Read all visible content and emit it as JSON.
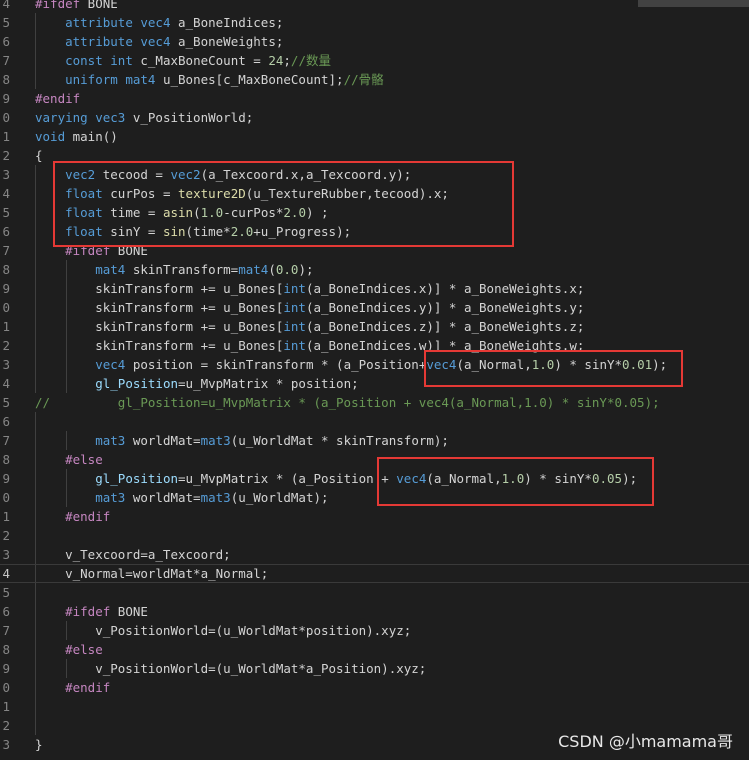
{
  "editor": {
    "lines": [
      {
        "n": "4",
        "t": "#ifdef BONE"
      },
      {
        "n": "5",
        "t": "    attribute vec4 a_BoneIndices;"
      },
      {
        "n": "6",
        "t": "    attribute vec4 a_BoneWeights;"
      },
      {
        "n": "7",
        "t": "    const int c_MaxBoneCount = 24;//数量"
      },
      {
        "n": "8",
        "t": "    uniform mat4 u_Bones[c_MaxBoneCount];//骨骼"
      },
      {
        "n": "9",
        "t": "#endif"
      },
      {
        "n": "0",
        "t": "varying vec3 v_PositionWorld;"
      },
      {
        "n": "1",
        "t": "void main()"
      },
      {
        "n": "2",
        "t": "{"
      },
      {
        "n": "3",
        "t": "    vec2 tecood = vec2(a_Texcoord.x,a_Texcoord.y);"
      },
      {
        "n": "4",
        "t": "    float curPos = texture2D(u_TextureRubber,tecood).x;"
      },
      {
        "n": "5",
        "t": "    float time = asin(1.0-curPos*2.0) ;"
      },
      {
        "n": "6",
        "t": "    float sinY = sin(time*2.0+u_Progress);"
      },
      {
        "n": "7",
        "t": "    #ifdef BONE"
      },
      {
        "n": "8",
        "t": "        mat4 skinTransform=mat4(0.0);"
      },
      {
        "n": "9",
        "t": "        skinTransform += u_Bones[int(a_BoneIndices.x)] * a_BoneWeights.x;"
      },
      {
        "n": "0",
        "t": "        skinTransform += u_Bones[int(a_BoneIndices.y)] * a_BoneWeights.y;"
      },
      {
        "n": "1",
        "t": "        skinTransform += u_Bones[int(a_BoneIndices.z)] * a_BoneWeights.z;"
      },
      {
        "n": "2",
        "t": "        skinTransform += u_Bones[int(a_BoneIndices.w)] * a_BoneWeights.w;"
      },
      {
        "n": "3",
        "t": "        vec4 position = skinTransform * (a_Position+vec4(a_Normal,1.0) * sinY*0.01);"
      },
      {
        "n": "4",
        "t": "        gl_Position=u_MvpMatrix * position;"
      },
      {
        "n": "5",
        "t": "//         gl_Position=u_MvpMatrix * (a_Position + vec4(a_Normal,1.0) * sinY*0.05);"
      },
      {
        "n": "6",
        "t": ""
      },
      {
        "n": "7",
        "t": "        mat3 worldMat=mat3(u_WorldMat * skinTransform);"
      },
      {
        "n": "8",
        "t": "    #else"
      },
      {
        "n": "9",
        "t": "        gl_Position=u_MvpMatrix * (a_Position + vec4(a_Normal,1.0) * sinY*0.05);"
      },
      {
        "n": "0",
        "t": "        mat3 worldMat=mat3(u_WorldMat);"
      },
      {
        "n": "1",
        "t": "    #endif"
      },
      {
        "n": "2",
        "t": ""
      },
      {
        "n": "3",
        "t": "    v_Texcoord=a_Texcoord;"
      },
      {
        "n": "4",
        "t": "    v_Normal=worldMat*a_Normal;"
      },
      {
        "n": "5",
        "t": ""
      },
      {
        "n": "6",
        "t": "    #ifdef BONE"
      },
      {
        "n": "7",
        "t": "        v_PositionWorld=(u_WorldMat*position).xyz;"
      },
      {
        "n": "8",
        "t": "    #else"
      },
      {
        "n": "9",
        "t": "        v_PositionWorld=(u_WorldMat*a_Position).xyz;"
      },
      {
        "n": "0",
        "t": "    #endif"
      },
      {
        "n": "1",
        "t": ""
      },
      {
        "n": "2",
        "t": ""
      },
      {
        "n": "3",
        "t": "}"
      }
    ],
    "current_line_index": 30,
    "colors": {
      "background": "#1e1e1e",
      "keyword": "#569cd6",
      "type": "#4ec9b0",
      "function": "#dcdcaa",
      "number": "#b5cea8",
      "comment": "#6a9955",
      "preprocessor": "#c586c0",
      "highlight_box": "#e53935"
    }
  },
  "watermark": "CSDN @小mamama哥"
}
